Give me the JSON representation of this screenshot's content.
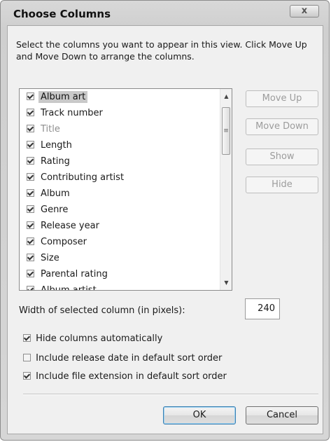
{
  "window": {
    "title": "Choose Columns",
    "close_glyph": "x"
  },
  "instructions": "Select the columns you want to appear in this view. Click Move Up and Move Down to arrange the columns.",
  "columns_list": {
    "items": [
      {
        "label": "Album art",
        "checked": true,
        "selected": true,
        "greyed": false
      },
      {
        "label": "Track number",
        "checked": true,
        "selected": false,
        "greyed": false
      },
      {
        "label": "Title",
        "checked": true,
        "selected": false,
        "greyed": true
      },
      {
        "label": "Length",
        "checked": true,
        "selected": false,
        "greyed": false
      },
      {
        "label": "Rating",
        "checked": true,
        "selected": false,
        "greyed": false
      },
      {
        "label": "Contributing artist",
        "checked": true,
        "selected": false,
        "greyed": false
      },
      {
        "label": "Album",
        "checked": true,
        "selected": false,
        "greyed": false
      },
      {
        "label": "Genre",
        "checked": true,
        "selected": false,
        "greyed": false
      },
      {
        "label": "Release year",
        "checked": true,
        "selected": false,
        "greyed": false
      },
      {
        "label": "Composer",
        "checked": true,
        "selected": false,
        "greyed": false
      },
      {
        "label": "Size",
        "checked": true,
        "selected": false,
        "greyed": false
      },
      {
        "label": "Parental rating",
        "checked": true,
        "selected": false,
        "greyed": false
      },
      {
        "label": "Album artist",
        "checked": true,
        "selected": false,
        "greyed": false
      }
    ]
  },
  "side_buttons": {
    "move_up": "Move Up",
    "move_down": "Move Down",
    "show": "Show",
    "hide": "Hide"
  },
  "width_field": {
    "label": "Width of selected column (in pixels):",
    "value": "240"
  },
  "options": {
    "hide_auto": {
      "label": "Hide columns automatically",
      "checked": true
    },
    "release_date": {
      "label": "Include release date in default sort order",
      "checked": false
    },
    "file_ext": {
      "label": "Include file extension in default sort order",
      "checked": true
    }
  },
  "footer": {
    "ok_label": "OK",
    "cancel_label": "Cancel"
  },
  "icons": {
    "scroll_up": "triangle-up",
    "scroll_down": "triangle-down",
    "grip": "scroll-grip"
  }
}
